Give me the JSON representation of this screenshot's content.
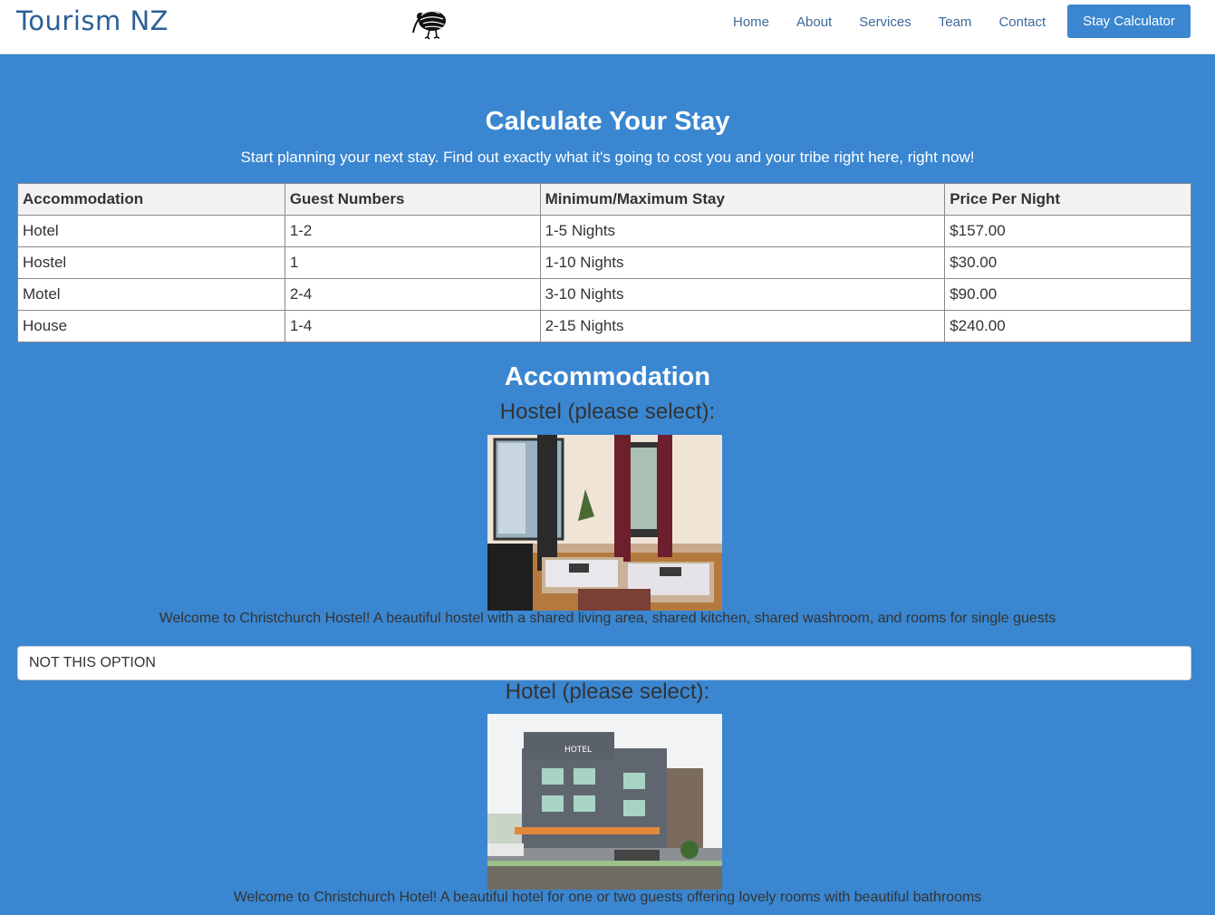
{
  "nav": {
    "brand": "Tourism NZ",
    "logo_icon": "kiwi-bird-icon",
    "links": [
      "Home",
      "About",
      "Services",
      "Team",
      "Contact"
    ],
    "cta": "Stay Calculator"
  },
  "calculator": {
    "title": "Calculate Your Stay",
    "subtitle": "Start planning your next stay. Find out exactly what it's going to cost you and your tribe right here, right now!"
  },
  "table": {
    "headers": [
      "Accommodation",
      "Guest Numbers",
      "Minimum/Maximum Stay",
      "Price Per Night"
    ],
    "rows": [
      [
        "Hotel",
        "1-2",
        "1-5 Nights",
        "$157.00"
      ],
      [
        "Hostel",
        "1",
        "1-10 Nights",
        "$30.00"
      ],
      [
        "Motel",
        "2-4",
        "3-10 Nights",
        "$90.00"
      ],
      [
        "House",
        "1-4",
        "2-15 Nights",
        "$240.00"
      ]
    ]
  },
  "accommodation": {
    "title": "Accommodation",
    "hostel": {
      "label": "Hostel (please select):",
      "description": "Welcome to Christchurch Hostel! A beautiful hostel with a shared living area, shared kitchen, shared washroom, and rooms for single guests",
      "select_value": "NOT THIS OPTION"
    },
    "hotel": {
      "label": "Hotel (please select):",
      "sign": "HOTEL",
      "description": "Welcome to Christchurch Hotel! A beautiful hotel for one or two guests offering lovely rooms with beautiful bathrooms"
    }
  }
}
